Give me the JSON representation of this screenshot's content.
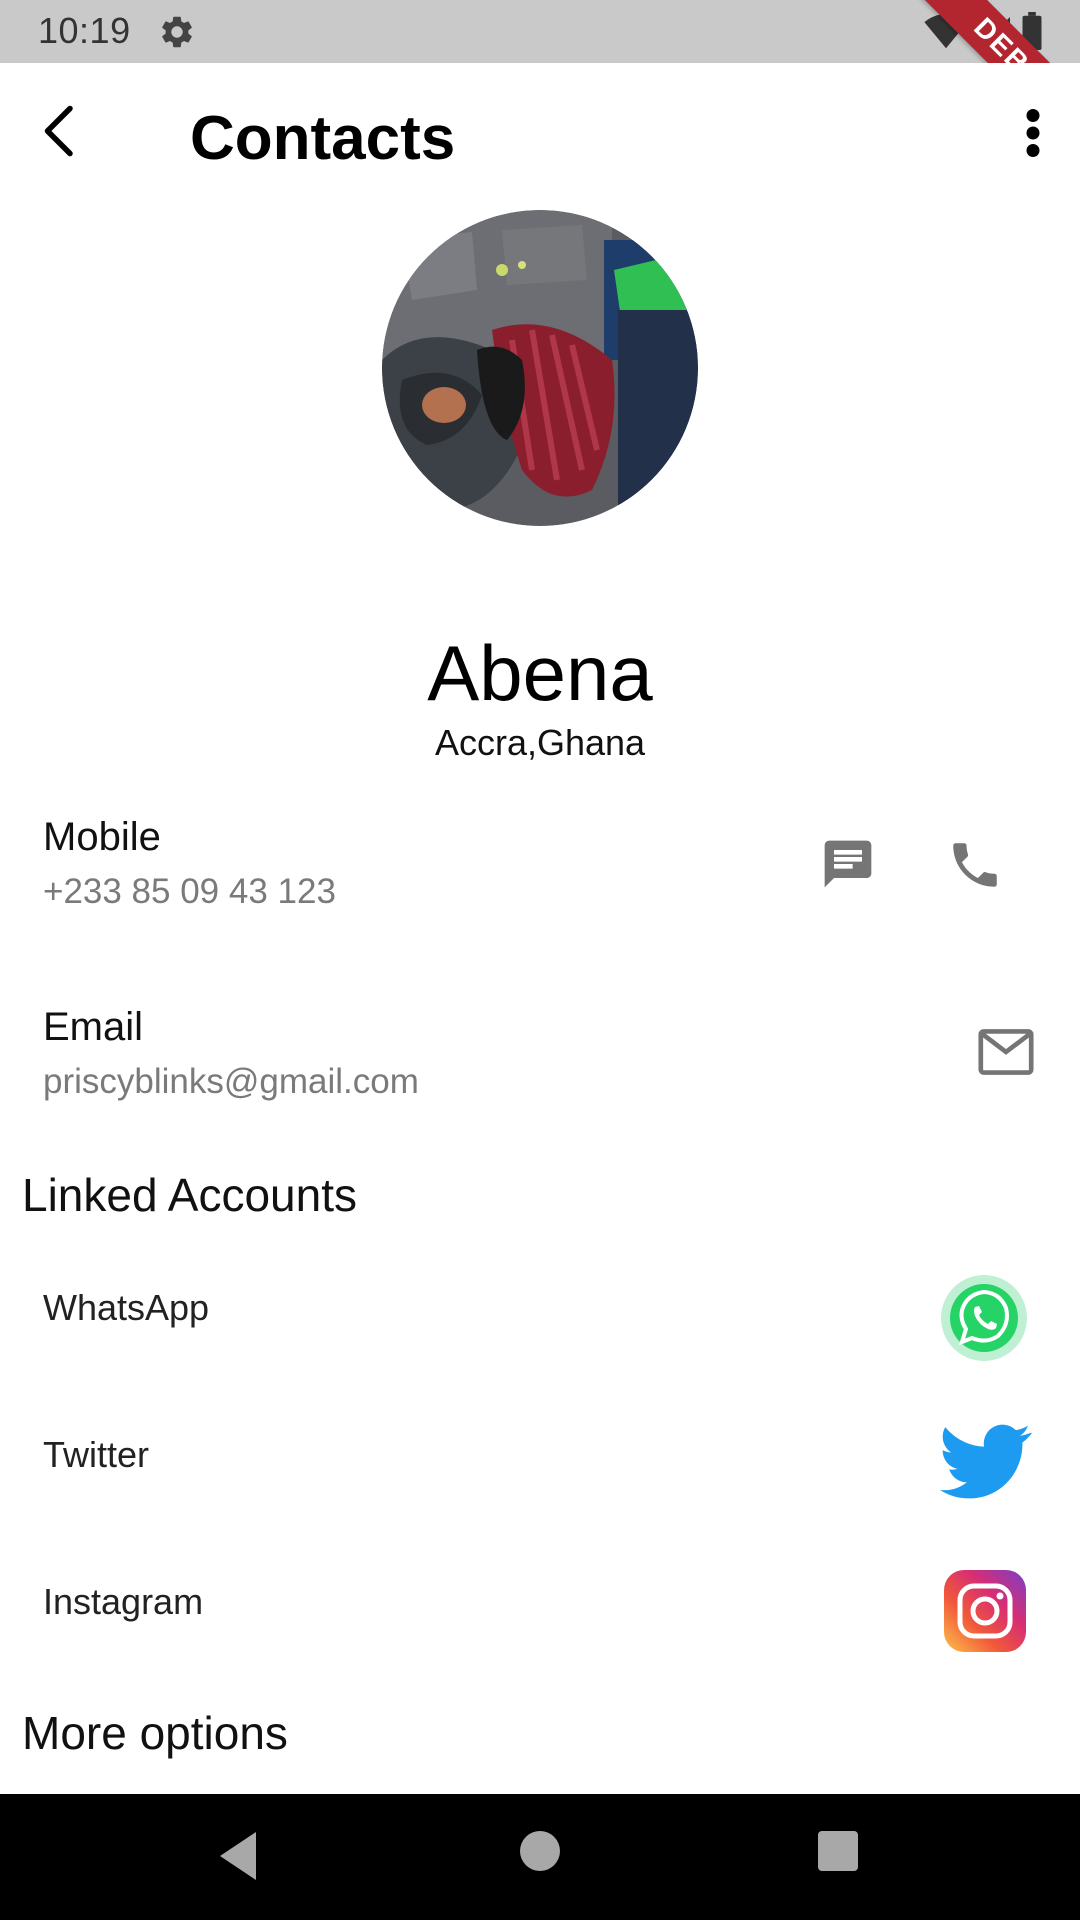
{
  "status_bar": {
    "time": "10:19",
    "debug_label": "DEBUG"
  },
  "app_bar": {
    "title": "Contacts"
  },
  "profile": {
    "name": "Abena",
    "location": "Accra,Ghana"
  },
  "mobile": {
    "label": "Mobile",
    "value": "+233 85 09 43 123"
  },
  "email": {
    "label": "Email",
    "value": "priscyblinks@gmail.com"
  },
  "linked_accounts": {
    "title": "Linked Accounts",
    "items": [
      {
        "label": "WhatsApp",
        "icon": "whatsapp-icon"
      },
      {
        "label": "Twitter",
        "icon": "twitter-icon"
      },
      {
        "label": "Instagram",
        "icon": "instagram-icon"
      }
    ]
  },
  "more_options": {
    "title": "More options"
  },
  "colors": {
    "status_bar": "#c9c9c9",
    "debug_banner": "#b3262f",
    "icon_grey": "#757575",
    "whatsapp": "#25d366",
    "twitter": "#1d9bf0",
    "nav_bar": "#000000"
  }
}
